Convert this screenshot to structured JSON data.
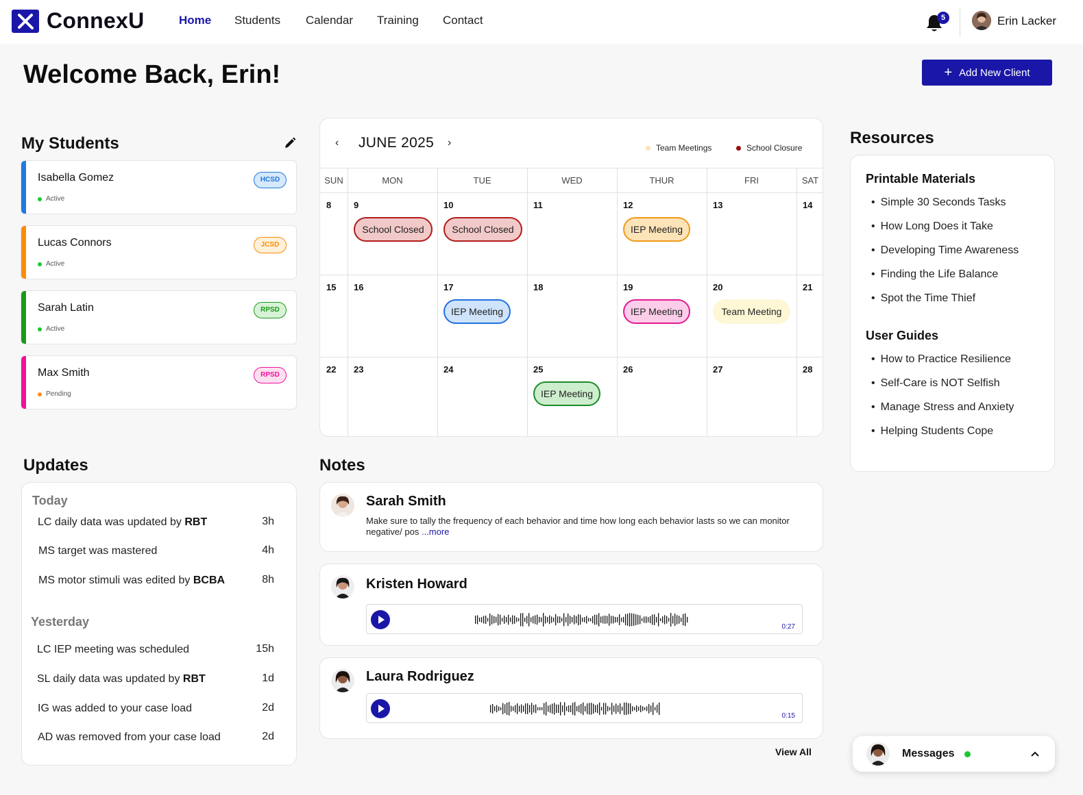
{
  "app": {
    "logo_text": "ConnexU",
    "user_name": "Erin Lacker",
    "notification_count": "5"
  },
  "nav": {
    "links": [
      "Home",
      "Students",
      "Calendar",
      "Training",
      "Contact"
    ],
    "active": "Home"
  },
  "header": {
    "welcome": "Welcome Back, Erin!",
    "add_client_label": "Add New Client"
  },
  "students": {
    "title": "My Students",
    "items": [
      {
        "name": "Isabella Gomez",
        "status": "Active",
        "district": "HCSD",
        "color": "#1f7ae0",
        "badge_bg": "#d6e8fb",
        "dot": "#19c832"
      },
      {
        "name": "Lucas Connors",
        "status": "Active",
        "district": "JCSD",
        "color": "#ff8c00",
        "badge_bg": "#fff0d9",
        "dot": "#19c832"
      },
      {
        "name": "Sarah Latin",
        "status": "Active",
        "district": "RPSD",
        "color": "#1a9a1a",
        "badge_bg": "#d8f2d6",
        "dot": "#19c832"
      },
      {
        "name": "Max Smith",
        "status": "Pending",
        "district": "RPSD",
        "color": "#f0129a",
        "badge_bg": "#fde0f0",
        "dot": "#ff8c1a"
      }
    ]
  },
  "calendar": {
    "month": "JUNE 2025",
    "legend": [
      {
        "label": "Team Meetings",
        "color": "#fde1b3"
      },
      {
        "label": "School Closure",
        "color": "#9b0e0e"
      }
    ],
    "weekdays": [
      "SUN",
      "MON",
      "TUE",
      "WED",
      "THUR",
      "FRI",
      "SAT"
    ],
    "weeks": [
      [
        "8",
        "9",
        "10",
        "11",
        "12",
        "13",
        "14"
      ],
      [
        "15",
        "16",
        "17",
        "18",
        "19",
        "20",
        "21"
      ],
      [
        "22",
        "23",
        "24",
        "25",
        "26",
        "27",
        "28"
      ]
    ],
    "events": [
      {
        "week": 0,
        "day": 1,
        "label": "School Closed",
        "bg": "#f2c9c9",
        "border": "#b21a1a"
      },
      {
        "week": 0,
        "day": 2,
        "label": "School Closed",
        "bg": "#f2c9c9",
        "border": "#b21a1a"
      },
      {
        "week": 0,
        "day": 4,
        "label": "IEP Meeting",
        "bg": "#fde3b8",
        "border": "#f09a1a"
      },
      {
        "week": 1,
        "day": 2,
        "label": "IEP Meeting",
        "bg": "#cfe3fb",
        "border": "#1f6fe0"
      },
      {
        "week": 1,
        "day": 4,
        "label": "IEP Meeting",
        "bg": "#fbcde8",
        "border": "#e21a92"
      },
      {
        "week": 1,
        "day": 5,
        "label": "Team Meeting",
        "bg": "#fdf7d6",
        "border": "#fdf7d6"
      },
      {
        "week": 2,
        "day": 3,
        "label": "IEP Meeting",
        "bg": "#cdeecd",
        "border": "#1a8a2a"
      }
    ]
  },
  "resources": {
    "title": "Resources",
    "groups": [
      {
        "title": "Printable Materials",
        "items": [
          "Simple 30 Seconds Tasks",
          "How Long Does it Take",
          "Developing Time Awareness",
          "Finding the Life Balance",
          "Spot the Time Thief"
        ]
      },
      {
        "title": "User Guides",
        "items": [
          "How to Practice Resilience",
          "Self-Care is NOT Selfish",
          "Manage Stress and Anxiety",
          "Helping Students Cope"
        ]
      }
    ]
  },
  "updates": {
    "title": "Updates",
    "groups": [
      {
        "label": "Today",
        "items": [
          {
            "text": "LC daily data was updated by ",
            "bold": "RBT",
            "time": "3h"
          },
          {
            "text": "MS target was mastered",
            "bold": "",
            "time": "4h"
          },
          {
            "text": "MS motor stimuli was edited by ",
            "bold": "BCBA",
            "time": "8h"
          }
        ]
      },
      {
        "label": "Yesterday",
        "items": [
          {
            "text": "LC IEP meeting was scheduled",
            "bold": "",
            "time": "15h"
          },
          {
            "text": "SL daily data was updated by ",
            "bold": "RBT",
            "time": "1d"
          },
          {
            "text": "IG was added to your case load",
            "bold": "",
            "time": "2d"
          },
          {
            "text": "AD was removed from your case load",
            "bold": "",
            "time": "2d"
          }
        ]
      }
    ]
  },
  "notes": {
    "title": "Notes",
    "items": [
      {
        "author": "Sarah Smith",
        "text": "Make sure to tally the frequency of each behavior and time how long each behavior lasts so we can monitor negative/ pos",
        "more": "...more"
      },
      {
        "author": "Kristen Howard",
        "duration": "0:27"
      },
      {
        "author": "Laura Rodriguez",
        "duration": "0:15"
      }
    ],
    "view_all": "View All"
  },
  "messages": {
    "label": "Messages"
  },
  "colors": {
    "brand": "#1a17a8",
    "online": "#19c832"
  }
}
